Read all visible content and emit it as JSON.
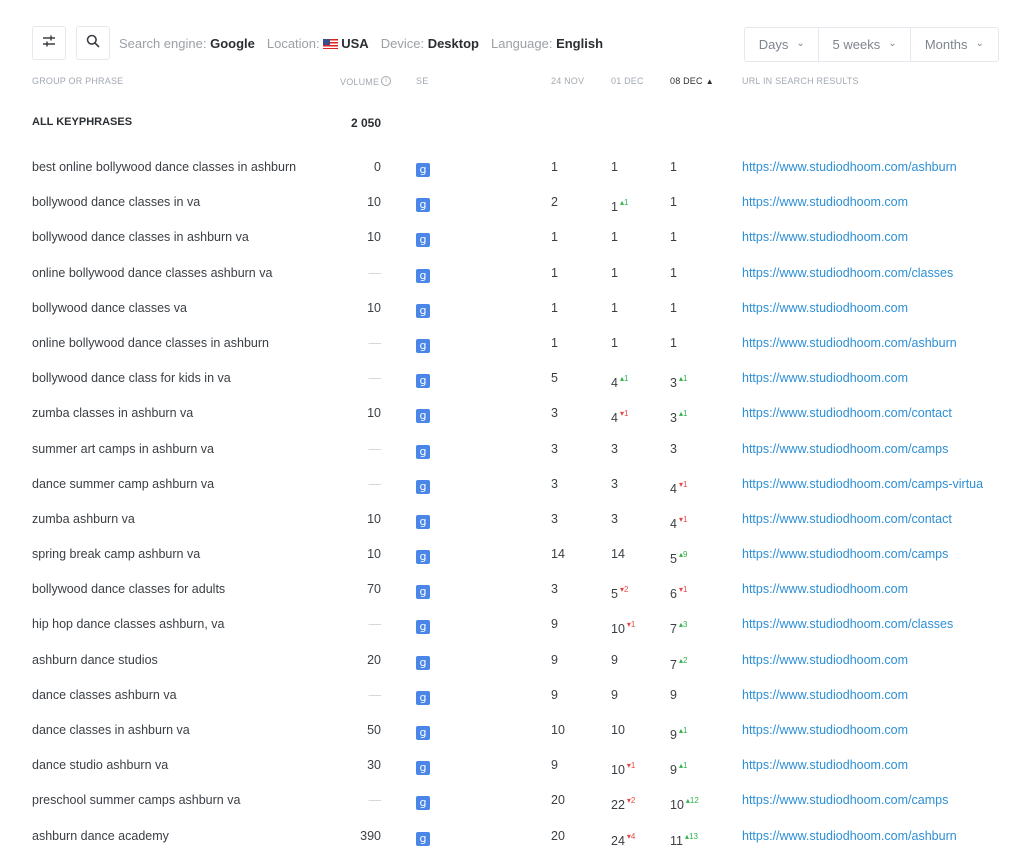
{
  "filters": {
    "engine_label": "Search engine:",
    "engine_value": "Google",
    "location_label": "Location:",
    "location_value": "USA",
    "device_label": "Device:",
    "device_value": "Desktop",
    "language_label": "Language:",
    "language_value": "English"
  },
  "period": {
    "days": "Days",
    "weeks": "5 weeks",
    "months": "Months"
  },
  "columns": {
    "phrase": "GROUP OR PHRASE",
    "volume": "VOLUME",
    "se": "SE",
    "d1": "24 NOV",
    "d2": "01 DEC",
    "d3": "08 DEC",
    "url": "URL IN SEARCH RESULTS"
  },
  "summary": {
    "label": "ALL KEYPHRASES",
    "volume": "2 050"
  },
  "rows": [
    {
      "phrase": "best online bollywood dance classes in ashburn",
      "volume": "0",
      "p1": "1",
      "p2": "1",
      "p3": "1",
      "url": "https://www.studiodhoom.com/ashburn"
    },
    {
      "phrase": "bollywood dance classes in va",
      "volume": "10",
      "p1": "2",
      "p2": "1",
      "p2d": "1",
      "p2dir": "up",
      "p3": "1",
      "url": "https://www.studiodhoom.com"
    },
    {
      "phrase": "bollywood dance classes in ashburn va",
      "volume": "10",
      "p1": "1",
      "p2": "1",
      "p3": "1",
      "url": "https://www.studiodhoom.com"
    },
    {
      "phrase": "online bollywood dance classes ashburn va",
      "volume": "—",
      "p1": "1",
      "p2": "1",
      "p3": "1",
      "url": "https://www.studiodhoom.com/classes"
    },
    {
      "phrase": "bollywood dance classes va",
      "volume": "10",
      "p1": "1",
      "p2": "1",
      "p3": "1",
      "url": "https://www.studiodhoom.com"
    },
    {
      "phrase": "online bollywood dance classes in ashburn",
      "volume": "—",
      "p1": "1",
      "p2": "1",
      "p3": "1",
      "url": "https://www.studiodhoom.com/ashburn"
    },
    {
      "phrase": "bollywood dance class for kids in va",
      "volume": "—",
      "p1": "5",
      "p2": "4",
      "p2d": "1",
      "p2dir": "up",
      "p3": "3",
      "p3d": "1",
      "p3dir": "up",
      "url": "https://www.studiodhoom.com"
    },
    {
      "phrase": "zumba classes in ashburn va",
      "volume": "10",
      "p1": "3",
      "p2": "4",
      "p2d": "1",
      "p2dir": "down",
      "p3": "3",
      "p3d": "1",
      "p3dir": "up",
      "url": "https://www.studiodhoom.com/contact"
    },
    {
      "phrase": "summer art camps in ashburn va",
      "volume": "—",
      "p1": "3",
      "p2": "3",
      "p3": "3",
      "url": "https://www.studiodhoom.com/camps"
    },
    {
      "phrase": "dance summer camp ashburn va",
      "volume": "—",
      "p1": "3",
      "p2": "3",
      "p3": "4",
      "p3d": "1",
      "p3dir": "down",
      "url": "https://www.studiodhoom.com/camps-virtua"
    },
    {
      "phrase": "zumba ashburn va",
      "volume": "10",
      "p1": "3",
      "p2": "3",
      "p3": "4",
      "p3d": "1",
      "p3dir": "down",
      "url": "https://www.studiodhoom.com/contact"
    },
    {
      "phrase": "spring break camp ashburn va",
      "volume": "10",
      "p1": "14",
      "p2": "14",
      "p3": "5",
      "p3d": "9",
      "p3dir": "up",
      "url": "https://www.studiodhoom.com/camps"
    },
    {
      "phrase": "bollywood dance classes for adults",
      "volume": "70",
      "p1": "3",
      "p2": "5",
      "p2d": "2",
      "p2dir": "down",
      "p3": "6",
      "p3d": "1",
      "p3dir": "down",
      "url": "https://www.studiodhoom.com"
    },
    {
      "phrase": "hip hop dance classes ashburn, va",
      "volume": "—",
      "p1": "9",
      "p2": "10",
      "p2d": "1",
      "p2dir": "down",
      "p3": "7",
      "p3d": "3",
      "p3dir": "up",
      "url": "https://www.studiodhoom.com/classes"
    },
    {
      "phrase": "ashburn dance studios",
      "volume": "20",
      "p1": "9",
      "p2": "9",
      "p3": "7",
      "p3d": "2",
      "p3dir": "up",
      "url": "https://www.studiodhoom.com"
    },
    {
      "phrase": "dance classes ashburn va",
      "volume": "—",
      "p1": "9",
      "p2": "9",
      "p3": "9",
      "url": "https://www.studiodhoom.com"
    },
    {
      "phrase": "dance classes in ashburn va",
      "volume": "50",
      "p1": "10",
      "p2": "10",
      "p3": "9",
      "p3d": "1",
      "p3dir": "up",
      "url": "https://www.studiodhoom.com"
    },
    {
      "phrase": "dance studio ashburn va",
      "volume": "30",
      "p1": "9",
      "p2": "10",
      "p2d": "1",
      "p2dir": "down",
      "p3": "9",
      "p3d": "1",
      "p3dir": "up",
      "url": "https://www.studiodhoom.com"
    },
    {
      "phrase": "preschool summer camps ashburn va",
      "volume": "—",
      "p1": "20",
      "p2": "22",
      "p2d": "2",
      "p2dir": "down",
      "p3": "10",
      "p3d": "12",
      "p3dir": "up",
      "url": "https://www.studiodhoom.com/camps"
    },
    {
      "phrase": "ashburn dance academy",
      "volume": "390",
      "p1": "20",
      "p2": "24",
      "p2d": "4",
      "p2dir": "down",
      "p3": "11",
      "p3d": "13",
      "p3dir": "up",
      "url": "https://www.studiodhoom.com/ashburn"
    }
  ],
  "colors": {
    "link": "#2d8fd5",
    "up": "#2fb24a",
    "down": "#e54848",
    "google_badge": "#4a86e8"
  },
  "icons": {
    "settings": "sliders-icon",
    "search": "search-icon",
    "engine": "google-icon",
    "sort": "sort-asc-icon",
    "info": "info-icon"
  }
}
